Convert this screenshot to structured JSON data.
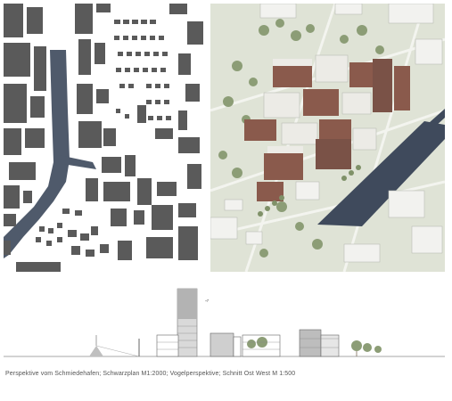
{
  "caption": "Perspektive vom Schmiedehafen; Schwarzplan M1:2000; Vogelperspektive; Schnitt Ost West M 1:500",
  "colors": {
    "building": "#5a5a5a",
    "water": "#4f5a6b",
    "aerial_ground": "#dfe3d6",
    "aerial_water": "#3f4a5c",
    "brick": "#8a5a4c",
    "tree": "#8c9d76"
  },
  "panels": [
    "schwarzplan",
    "vogelperspektive",
    "schnitt-ost-west"
  ]
}
